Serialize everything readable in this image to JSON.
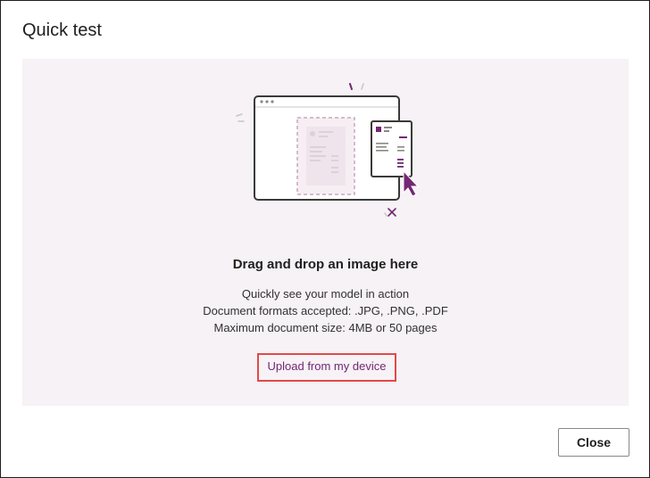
{
  "dialog": {
    "title": "Quick test"
  },
  "drop_zone": {
    "heading": "Drag and drop an image here",
    "lines": [
      "Quickly see your model in action",
      "Document formats accepted: .JPG, .PNG, .PDF",
      "Maximum document size: 4MB or 50 pages"
    ],
    "upload_label": "Upload from my device"
  },
  "footer": {
    "close_label": "Close"
  },
  "colors": {
    "accent": "#742774",
    "highlight_border": "#e2494a",
    "drop_zone_bg": "#f6f2f5"
  },
  "icons": {
    "illustration": "drag-drop-document-illustration"
  }
}
